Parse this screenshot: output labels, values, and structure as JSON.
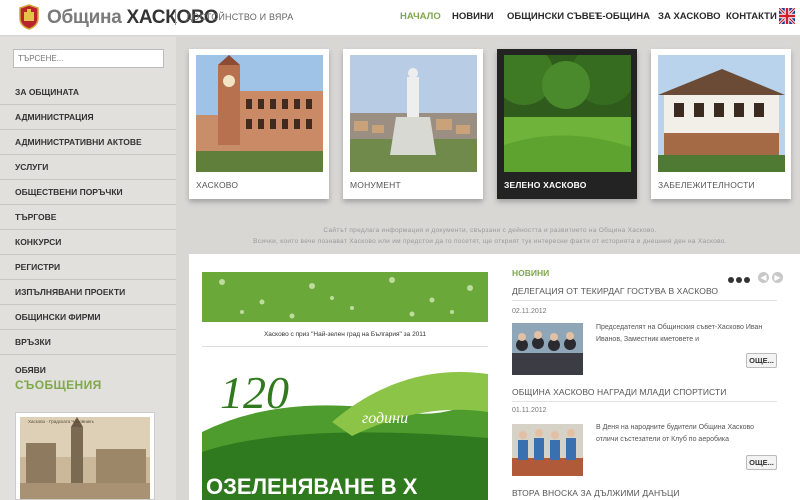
{
  "header": {
    "brand_prefix": "Община",
    "brand_name": "ХАСКОВО",
    "tagline": "ДОСТОЙНСТВО И ВЯРА",
    "nav": [
      "НАЧАЛО",
      "НОВИНИ",
      "ОБЩИНСКИ СЪВЕТ",
      "Е-ОБЩИНА",
      "ЗА ХАСКОВО",
      "КОНТАКТИ"
    ],
    "active_nav": "НАЧАЛО",
    "language_flag": "uk-flag-icon"
  },
  "sidebar": {
    "search_placeholder": "ТЪРСЕНЕ...",
    "items": [
      "ЗА ОБЩИНАТА",
      "АДМИНИСТРАЦИЯ",
      "АДМИНИСТРАТИВНИ АКТОВЕ",
      "УСЛУГИ",
      "ОБЩЕСТВЕНИ ПОРЪЧКИ",
      "ТЪРГОВЕ",
      "КОНКУРСИ",
      "РЕГИСТРИ",
      "ИЗПЪЛНЯВАНИ ПРОЕКТИ",
      "ОБЩИНСКИ ФИРМИ",
      "ВРЪЗКИ"
    ],
    "ads_title": "ОБЯВИ",
    "messages_title": "СЪОБЩЕНИЯ",
    "photo_caption": "Хасково · Градската Часовникъ"
  },
  "tiles": [
    {
      "caption": "ХАСКОВО"
    },
    {
      "caption": "МОНУМЕНТ"
    },
    {
      "caption": "ЗЕЛЕНО ХАСКОВО"
    },
    {
      "caption": "ЗАБЕЛЕЖИТЕЛНОСТИ"
    }
  ],
  "intro": {
    "line1": "Сайтът предлага информация и документи, свързани с дейността и развитието на Община Хасково.",
    "line2": "Всички, които вече познават Хасково или им предстои да го посетят, ще открият тук интересни факти от историята и днешния ден на Хасково."
  },
  "banner": {
    "caption": "Хасково с приз \"Най-зелен град на България\" за 2011",
    "promo_number": "120",
    "promo_word": "години",
    "promo_text": "ОЗЕЛЕНЯВАНЕ В Х"
  },
  "news": {
    "title": "НОВИНИ",
    "more_label": "ОЩЕ...",
    "items": [
      {
        "headline": "ДЕЛЕГАЦИЯ ОТ ТЕКИРДАГ ГОСТУВА В ХАСКОВО",
        "date": "02.11.2012",
        "text": "Председателят на Общинския съвет-Хасково Иван Иванов, Заместник кметовете и"
      },
      {
        "headline": "ОБЩИНА ХАСКОВО НАГРАДИ МЛАДИ СПОРТИСТИ",
        "date": "01.11.2012",
        "text": "В Деня на народните будители Община Хасково отличи състезатели от Клуб по аеробика"
      },
      {
        "headline": "ВТОРА ВНОСКА ЗА ДЪЛЖИМИ ДАНЪЦИ",
        "date": "",
        "text": ""
      }
    ]
  },
  "colors": {
    "accent_green": "#7ea84a",
    "sidebar_bg": "#e2e0dd",
    "main_bg": "#d9d7d4"
  }
}
